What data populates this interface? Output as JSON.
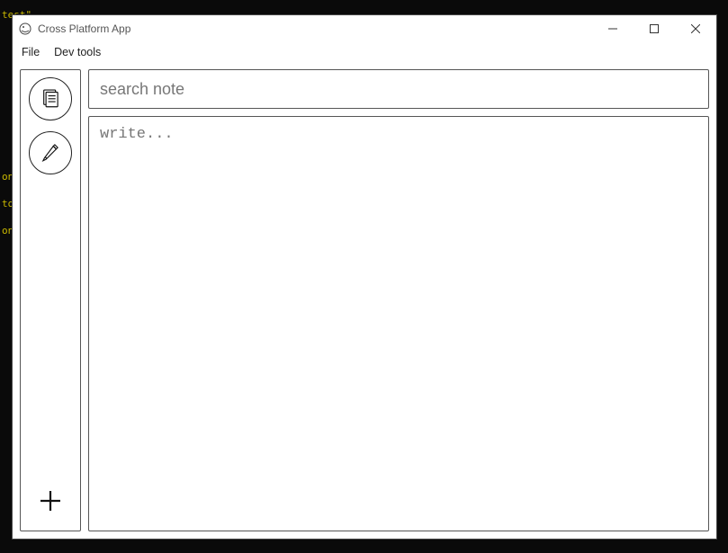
{
  "background_fragments": "test\"\n\n\n\n\n\non\nto\non",
  "window": {
    "title": "Cross Platform App"
  },
  "menubar": {
    "items": [
      "File",
      "Dev tools"
    ]
  },
  "sidebar": {
    "tools": [
      {
        "name": "notes-icon"
      },
      {
        "name": "pencil-icon"
      }
    ],
    "add_label": "+"
  },
  "main": {
    "search_placeholder": "search note",
    "search_value": "",
    "write_placeholder": "write...",
    "write_value": ""
  }
}
